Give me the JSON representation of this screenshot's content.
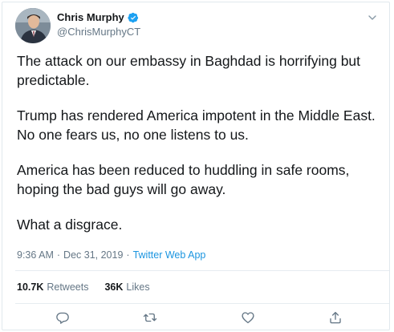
{
  "author": {
    "display_name": "Chris Murphy",
    "handle": "@ChrisMurphyCT",
    "verified": true
  },
  "tweet": {
    "paragraphs": [
      "The attack on our embassy in Baghdad is horrifying but predictable.",
      "Trump has rendered America impotent in the Middle East. No one fears us, no one listens to us.",
      "America has been reduced to huddling in safe rooms, hoping the bad guys will go away.",
      "What a disgrace."
    ],
    "time": "9:36 AM",
    "separator": "·",
    "date": "Dec 31, 2019",
    "source": "Twitter Web App"
  },
  "stats": {
    "retweets_count": "10.7K",
    "retweets_label": "Retweets",
    "likes_count": "36K",
    "likes_label": "Likes"
  },
  "icons": {
    "caret": "chevron-down-icon",
    "verified": "verified-badge-icon",
    "reply": "reply-icon",
    "retweet": "retweet-icon",
    "like": "heart-icon",
    "share": "share-icon"
  },
  "colors": {
    "text": "#14171a",
    "secondary": "#657786",
    "link": "#1b95e0",
    "verified": "#1da1f2",
    "divider": "#e6ecf0"
  }
}
